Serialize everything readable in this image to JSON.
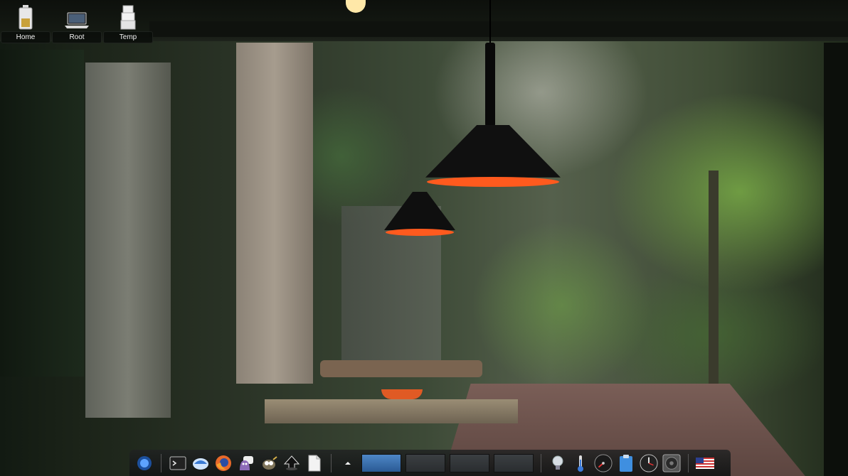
{
  "desktop": {
    "icons": [
      {
        "label": "Home",
        "icon": "battery-icon"
      },
      {
        "label": "Root",
        "icon": "laptop-icon"
      },
      {
        "label": "Temp",
        "icon": "box-stack-icon"
      }
    ]
  },
  "panel": {
    "launchers": [
      {
        "name": "thunderbird-app-icon"
      },
      {
        "name": "terminal-icon"
      },
      {
        "name": "bird-mail-icon"
      },
      {
        "name": "firefox-icon"
      },
      {
        "name": "pidgin-chat-icon"
      },
      {
        "name": "gimp-icon"
      },
      {
        "name": "inkscape-icon"
      },
      {
        "name": "text-editor-icon"
      }
    ],
    "tray_arrow": "up-arrow-icon",
    "workspaces": [
      {
        "index": 1,
        "active": true
      },
      {
        "index": 2,
        "active": false
      },
      {
        "index": 3,
        "active": false
      },
      {
        "index": 4,
        "active": false
      }
    ],
    "tray": [
      {
        "name": "lightbulb-icon"
      },
      {
        "name": "thermometer-icon"
      },
      {
        "name": "speedometer-icon"
      },
      {
        "name": "clipboard-icon"
      },
      {
        "name": "clock-icon"
      },
      {
        "name": "speaker-icon"
      },
      {
        "name": "us-flag-icon"
      }
    ]
  },
  "colors": {
    "lamp_glow": "#ff5a1e",
    "workspace_active": "#4e87c7"
  }
}
